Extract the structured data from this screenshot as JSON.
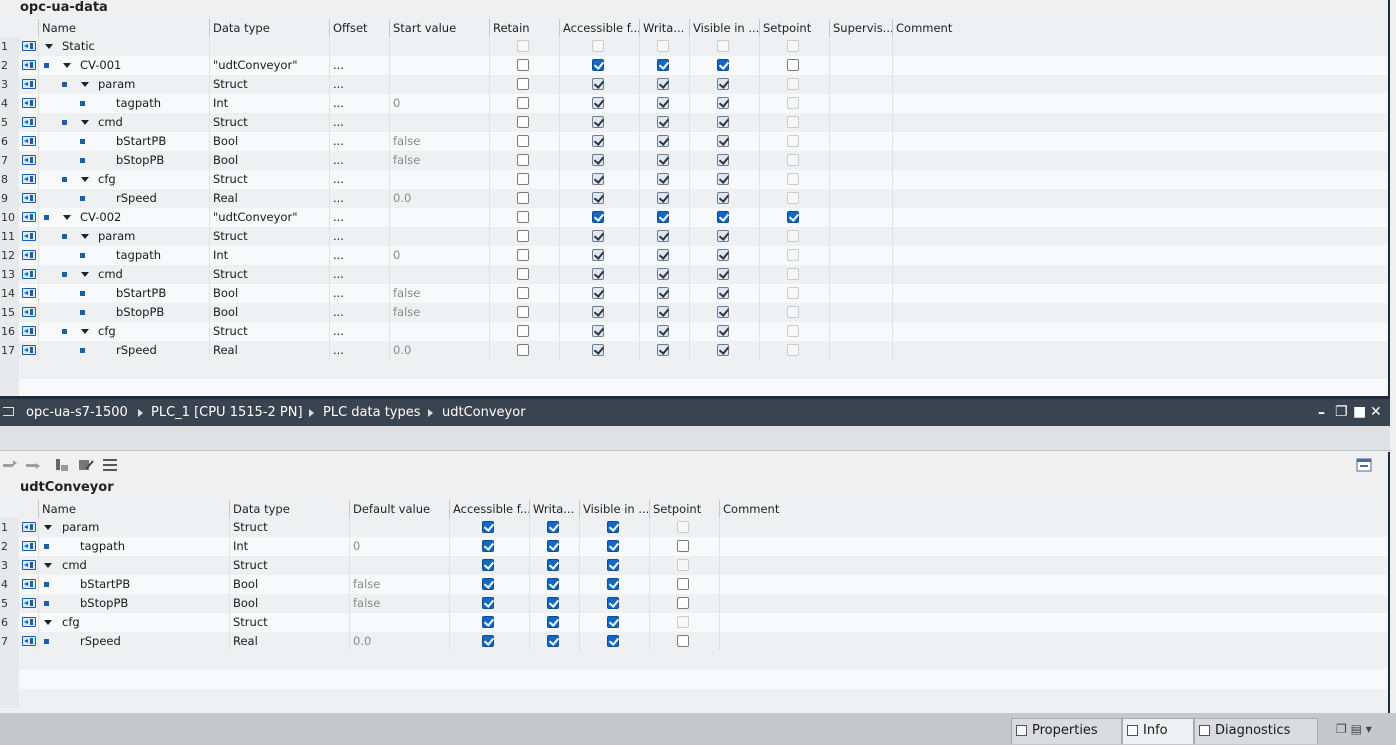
{
  "top_editor": {
    "title": "opc-ua-data",
    "columns": [
      "Name",
      "Data type",
      "Offset",
      "Start value",
      "Retain",
      "Accessible f...",
      "Writa...",
      "Visible in ...",
      "Setpoint",
      "Supervis...",
      "Comment"
    ],
    "rows": [
      {
        "num": "1",
        "indent": 0,
        "square": false,
        "expand": true,
        "name": "Static",
        "type": "",
        "offset": "",
        "start": "",
        "retain": "dis",
        "acc": "dis",
        "wri": "dis",
        "vis": "dis",
        "set": "dis"
      },
      {
        "num": "2",
        "indent": 1,
        "square": true,
        "expand": true,
        "name": "CV-001",
        "type": "\"udtConveyor\"",
        "offset": "...",
        "start": "",
        "retain": "on",
        "acc": "blue",
        "wri": "blue",
        "vis": "blue",
        "set": "on"
      },
      {
        "num": "3",
        "indent": 2,
        "square": true,
        "expand": true,
        "name": "param",
        "type": "Struct",
        "offset": "...",
        "start": "",
        "retain": "on",
        "acc": "chk",
        "wri": "chk",
        "vis": "chk",
        "set": "dis"
      },
      {
        "num": "4",
        "indent": 3,
        "square": true,
        "expand": false,
        "name": "tagpath",
        "type": "Int",
        "offset": "...",
        "start": "0",
        "retain": "on",
        "acc": "chk",
        "wri": "chk",
        "vis": "chk",
        "set": "dis"
      },
      {
        "num": "5",
        "indent": 2,
        "square": true,
        "expand": true,
        "name": "cmd",
        "type": "Struct",
        "offset": "...",
        "start": "",
        "retain": "on",
        "acc": "chk",
        "wri": "chk",
        "vis": "chk",
        "set": "dis"
      },
      {
        "num": "6",
        "indent": 3,
        "square": true,
        "expand": false,
        "name": "bStartPB",
        "type": "Bool",
        "offset": "...",
        "start": "false",
        "retain": "on",
        "acc": "chk",
        "wri": "chk",
        "vis": "chk",
        "set": "dis"
      },
      {
        "num": "7",
        "indent": 3,
        "square": true,
        "expand": false,
        "name": "bStopPB",
        "type": "Bool",
        "offset": "...",
        "start": "false",
        "retain": "on",
        "acc": "chk",
        "wri": "chk",
        "vis": "chk",
        "set": "dis"
      },
      {
        "num": "8",
        "indent": 2,
        "square": true,
        "expand": true,
        "name": "cfg",
        "type": "Struct",
        "offset": "...",
        "start": "",
        "retain": "on",
        "acc": "chk",
        "wri": "chk",
        "vis": "chk",
        "set": "dis"
      },
      {
        "num": "9",
        "indent": 3,
        "square": true,
        "expand": false,
        "name": "rSpeed",
        "type": "Real",
        "offset": "...",
        "start": "0.0",
        "retain": "on",
        "acc": "chk",
        "wri": "chk",
        "vis": "chk",
        "set": "dis"
      },
      {
        "num": "10",
        "indent": 1,
        "square": true,
        "expand": true,
        "name": "CV-002",
        "type": "\"udtConveyor\"",
        "offset": "...",
        "start": "",
        "retain": "on",
        "acc": "blue",
        "wri": "blue",
        "vis": "blue",
        "set": "blue"
      },
      {
        "num": "11",
        "indent": 2,
        "square": true,
        "expand": true,
        "name": "param",
        "type": "Struct",
        "offset": "...",
        "start": "",
        "retain": "on",
        "acc": "chk",
        "wri": "chk",
        "vis": "chk",
        "set": "dis"
      },
      {
        "num": "12",
        "indent": 3,
        "square": true,
        "expand": false,
        "name": "tagpath",
        "type": "Int",
        "offset": "...",
        "start": "0",
        "retain": "on",
        "acc": "chk",
        "wri": "chk",
        "vis": "chk",
        "set": "dis"
      },
      {
        "num": "13",
        "indent": 2,
        "square": true,
        "expand": true,
        "name": "cmd",
        "type": "Struct",
        "offset": "...",
        "start": "",
        "retain": "on",
        "acc": "chk",
        "wri": "chk",
        "vis": "chk",
        "set": "dis"
      },
      {
        "num": "14",
        "indent": 3,
        "square": true,
        "expand": false,
        "name": "bStartPB",
        "type": "Bool",
        "offset": "...",
        "start": "false",
        "retain": "on",
        "acc": "chk",
        "wri": "chk",
        "vis": "chk",
        "set": "dis"
      },
      {
        "num": "15",
        "indent": 3,
        "square": true,
        "expand": false,
        "name": "bStopPB",
        "type": "Bool",
        "offset": "...",
        "start": "false",
        "retain": "on",
        "acc": "chk",
        "wri": "chk",
        "vis": "chk",
        "set": "dis"
      },
      {
        "num": "16",
        "indent": 2,
        "square": true,
        "expand": true,
        "name": "cfg",
        "type": "Struct",
        "offset": "...",
        "start": "",
        "retain": "on",
        "acc": "chk",
        "wri": "chk",
        "vis": "chk",
        "set": "dis"
      },
      {
        "num": "17",
        "indent": 3,
        "square": true,
        "expand": false,
        "name": "rSpeed",
        "type": "Real",
        "offset": "...",
        "start": "0.0",
        "retain": "on",
        "acc": "chk",
        "wri": "chk",
        "vis": "chk",
        "set": "dis"
      }
    ]
  },
  "breadcrumb": [
    "opc-ua-s7-1500",
    "PLC_1 [CPU 1515-2 PN]",
    "PLC data types",
    "udtConveyor"
  ],
  "bottom_editor": {
    "title": "udtConveyor",
    "columns": [
      "Name",
      "Data type",
      "Default value",
      "Accessible f...",
      "Writa...",
      "Visible in ...",
      "Setpoint",
      "Comment"
    ],
    "rows": [
      {
        "num": "1",
        "indent": 0,
        "square": false,
        "expand": true,
        "name": "param",
        "type": "Struct",
        "def": "",
        "acc": "blue",
        "wri": "blue",
        "vis": "blue",
        "set": "dis"
      },
      {
        "num": "2",
        "indent": 1,
        "square": true,
        "expand": false,
        "name": "tagpath",
        "type": "Int",
        "def": "0",
        "acc": "blue",
        "wri": "blue",
        "vis": "blue",
        "set": "on"
      },
      {
        "num": "3",
        "indent": 0,
        "square": false,
        "expand": true,
        "name": "cmd",
        "type": "Struct",
        "def": "",
        "acc": "blue",
        "wri": "blue",
        "vis": "blue",
        "set": "dis"
      },
      {
        "num": "4",
        "indent": 1,
        "square": true,
        "expand": false,
        "name": "bStartPB",
        "type": "Bool",
        "def": "false",
        "acc": "blue",
        "wri": "blue",
        "vis": "blue",
        "set": "on"
      },
      {
        "num": "5",
        "indent": 1,
        "square": true,
        "expand": false,
        "name": "bStopPB",
        "type": "Bool",
        "def": "false",
        "acc": "blue",
        "wri": "blue",
        "vis": "blue",
        "set": "on"
      },
      {
        "num": "6",
        "indent": 0,
        "square": false,
        "expand": true,
        "name": "cfg",
        "type": "Struct",
        "def": "",
        "acc": "blue",
        "wri": "blue",
        "vis": "blue",
        "set": "dis"
      },
      {
        "num": "7",
        "indent": 1,
        "square": true,
        "expand": false,
        "name": "rSpeed",
        "type": "Real",
        "def": "0.0",
        "acc": "blue",
        "wri": "blue",
        "vis": "blue",
        "set": "on"
      }
    ]
  },
  "tabs": {
    "properties": "Properties",
    "info": "Info",
    "diagnostics": "Diagnostics"
  },
  "icons": [
    "interface-icon",
    "member-square-icon",
    "expand-triangle-icon",
    "minimize-icon",
    "restore-icon",
    "maximize-icon",
    "close-icon"
  ]
}
